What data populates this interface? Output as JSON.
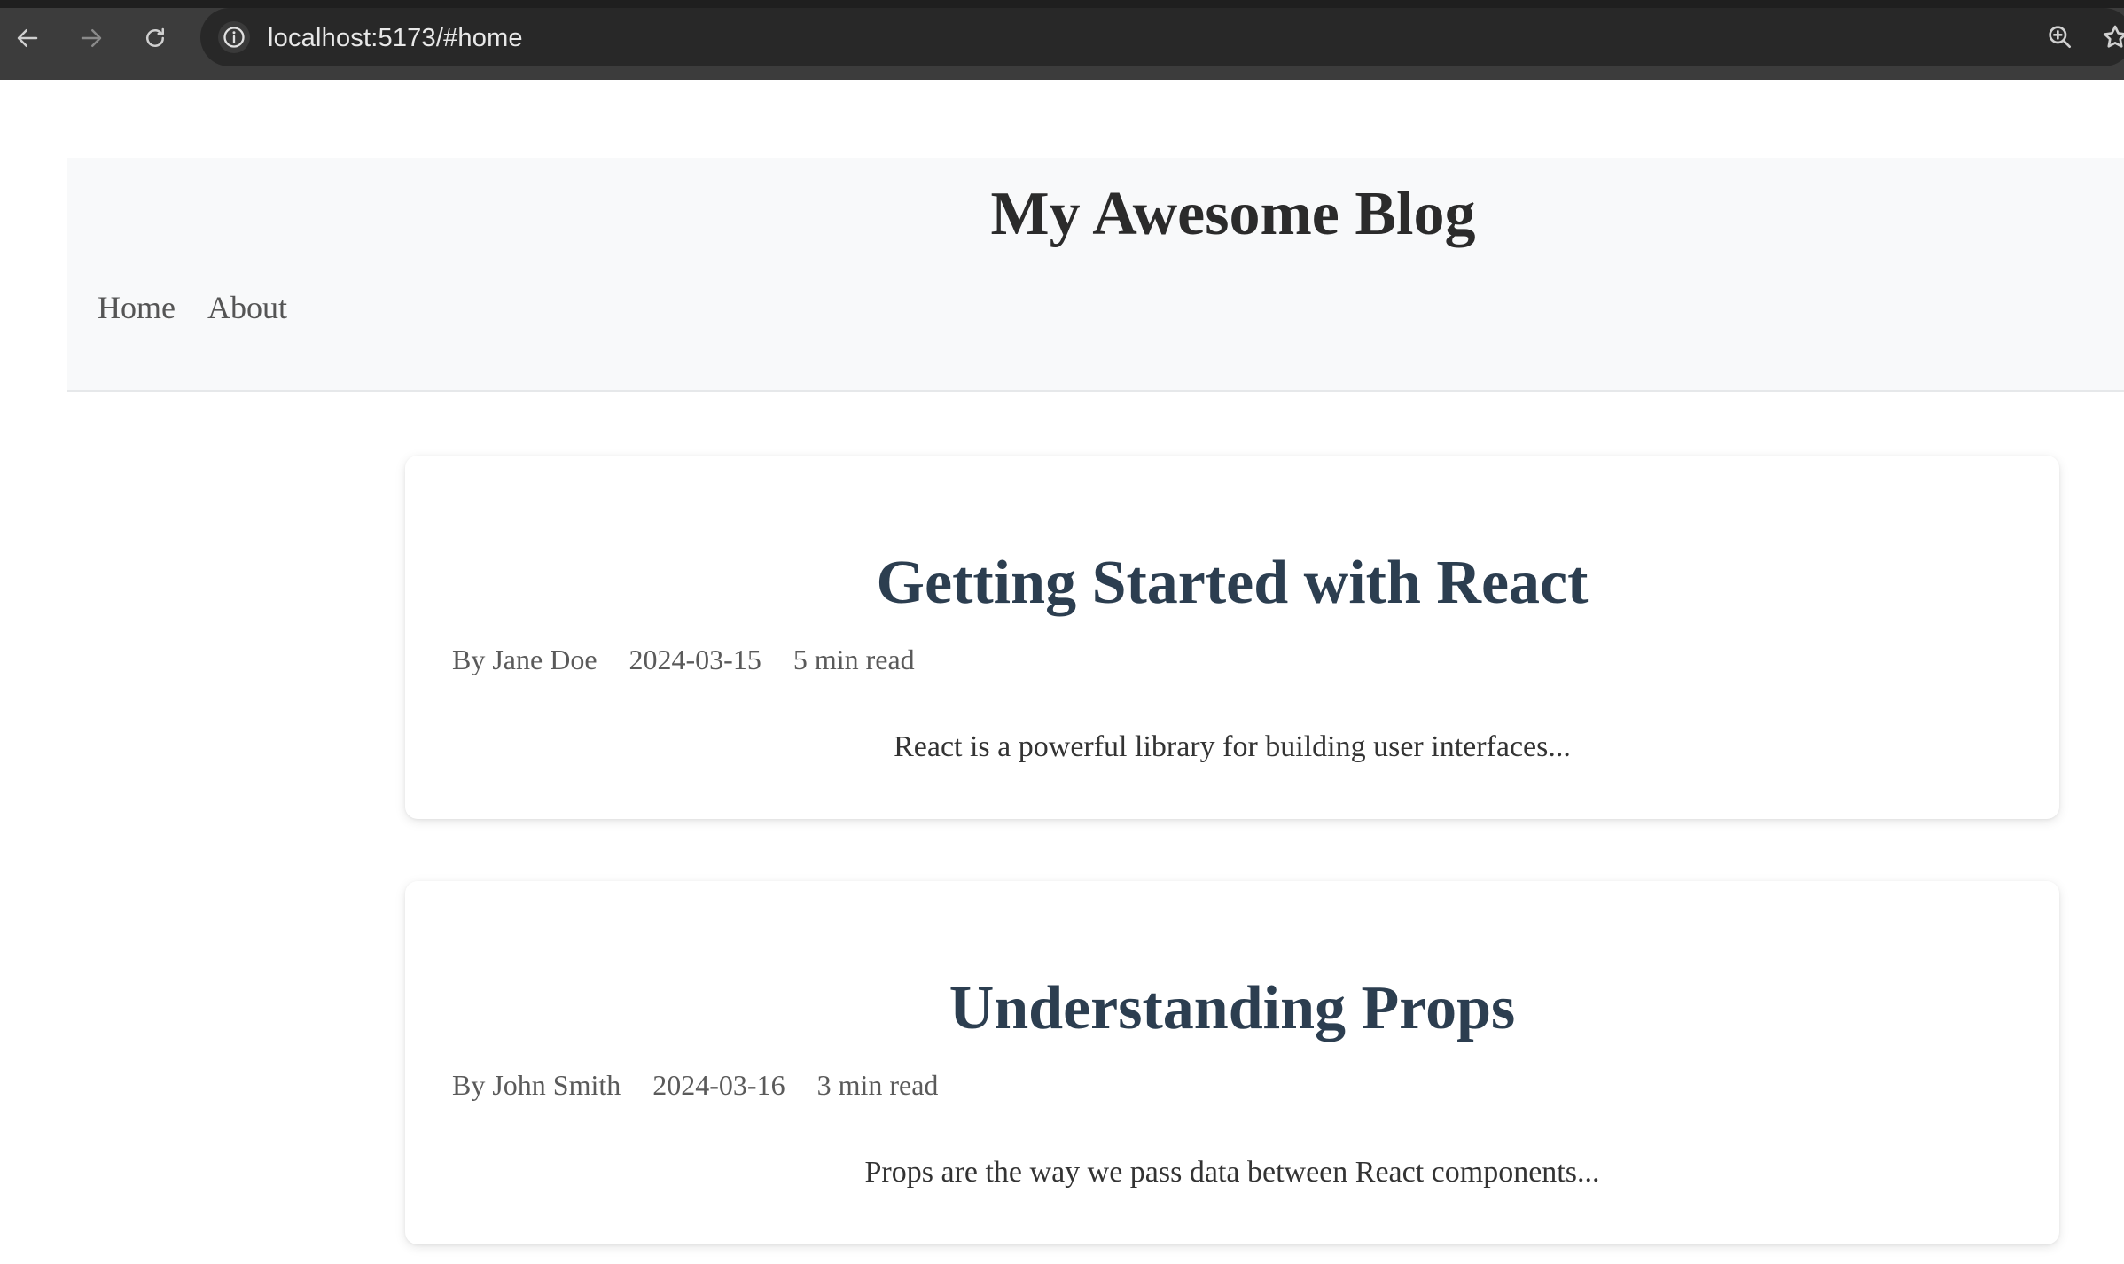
{
  "browser": {
    "url": "localhost:5173/#home"
  },
  "header": {
    "title": "My Awesome Blog",
    "nav": [
      {
        "label": "Home"
      },
      {
        "label": "About"
      }
    ]
  },
  "posts": [
    {
      "title": "Getting Started with React",
      "author": "By Jane Doe",
      "date": "2024-03-15",
      "read_time": "5 min read",
      "excerpt": "React is a powerful library for building user interfaces..."
    },
    {
      "title": "Understanding Props",
      "author": "By John Smith",
      "date": "2024-03-16",
      "read_time": "3 min read",
      "excerpt": "Props are the way we pass data between React components..."
    }
  ],
  "colors": {
    "header_bg": "#f8f9fa",
    "post_title": "#2c3e50",
    "chrome_bg": "#3c3c3c"
  }
}
